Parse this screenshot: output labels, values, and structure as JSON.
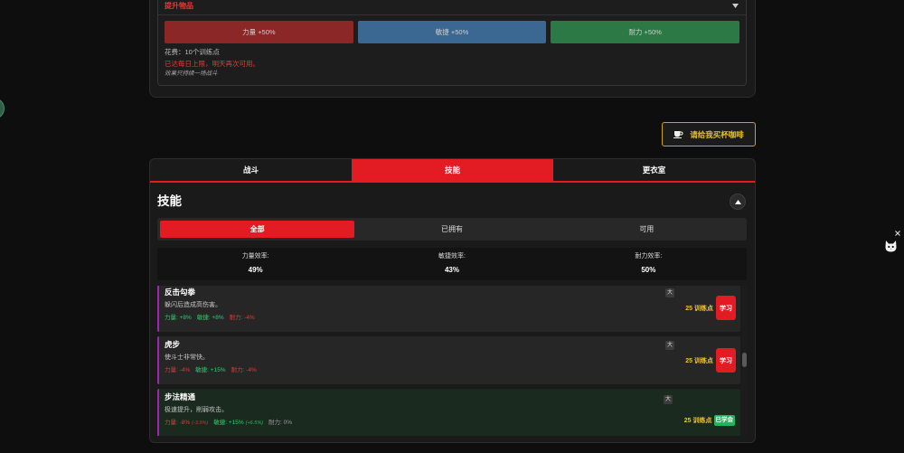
{
  "theme": {
    "accent": "#e31b23",
    "page_background": "#0e0e0e",
    "panel_background": "#1a1a1a",
    "positive": "#2ccf6c",
    "negative": "#e53935",
    "neutral": "#9a9a9a",
    "cost": "#f2c230",
    "learned_badge": "#22b35e",
    "skill_accent_border": "#9c27b0",
    "coffee_border": "#c9a21c"
  },
  "floating_button": {
    "color": "#2f5e49"
  },
  "boost": {
    "title": "提升物品",
    "toggle_icon": "chevron-down-icon",
    "buttons": [
      {
        "label": "力量 +50%",
        "color": "#8c2727"
      },
      {
        "label": "敏捷 +50%",
        "color": "#3a6893"
      },
      {
        "label": "耐力 +50%",
        "color": "#2d7946"
      }
    ],
    "cost": "花费：10个训练点",
    "limit_notice": "已达每日上限，明天再次可用。",
    "duration_note": "效果只持续一场战斗"
  },
  "coffee": {
    "icon": "coffee-icon",
    "label": "请给我买杯咖啡"
  },
  "tabs": [
    {
      "label": "战斗",
      "active": false
    },
    {
      "label": "技能",
      "active": true
    },
    {
      "label": "更衣室",
      "active": false
    }
  ],
  "skills_section": {
    "title": "技能",
    "collapse_icon": "chevron-up-icon",
    "filters": [
      {
        "label": "全部",
        "active": true
      },
      {
        "label": "已拥有",
        "active": false
      },
      {
        "label": "可用",
        "active": false
      }
    ],
    "efficiency": [
      {
        "label": "力量效率:",
        "value": "49%"
      },
      {
        "label": "敏捷效率:",
        "value": "43%"
      },
      {
        "label": "耐力效率:",
        "value": "50%"
      }
    ],
    "skills": [
      {
        "name": "反击勾拳",
        "description": "躲闪后造成高伤害。",
        "size_badge": "大",
        "cost": "25 训练点",
        "action": "学习",
        "learned": false,
        "stats": [
          {
            "text": "力量: +8%",
            "color": "#2ccf6c"
          },
          {
            "text": "敏捷: +8%",
            "color": "#2ccf6c"
          },
          {
            "text": "耐力: -4%",
            "color": "#e53935"
          }
        ]
      },
      {
        "name": "虎步",
        "description": "使斗士非常快。",
        "size_badge": "大",
        "cost": "25 训练点",
        "action": "学习",
        "learned": false,
        "stats": [
          {
            "text": "力量: -4%",
            "color": "#e53935"
          },
          {
            "text": "敏捷: +15%",
            "color": "#2ccf6c"
          },
          {
            "text": "耐力: -4%",
            "color": "#e53935"
          }
        ]
      },
      {
        "name": "步法精通",
        "description": "极速提升，削弱攻击。",
        "size_badge": "大",
        "cost": "25 训练点",
        "status": "已学会",
        "learned": true,
        "stats": [
          {
            "text": "力量: -8%",
            "effective": "(-3.9%)",
            "color": "#e53935"
          },
          {
            "text": "敏捷: +15%",
            "effective": "(+6.5%)",
            "color": "#2ccf6c"
          },
          {
            "text": "耐力: 0%",
            "color": "#9a9a9a"
          }
        ]
      }
    ]
  },
  "side_widget": {
    "close_icon": "close-icon",
    "mascot_icon": "cat-icon"
  }
}
